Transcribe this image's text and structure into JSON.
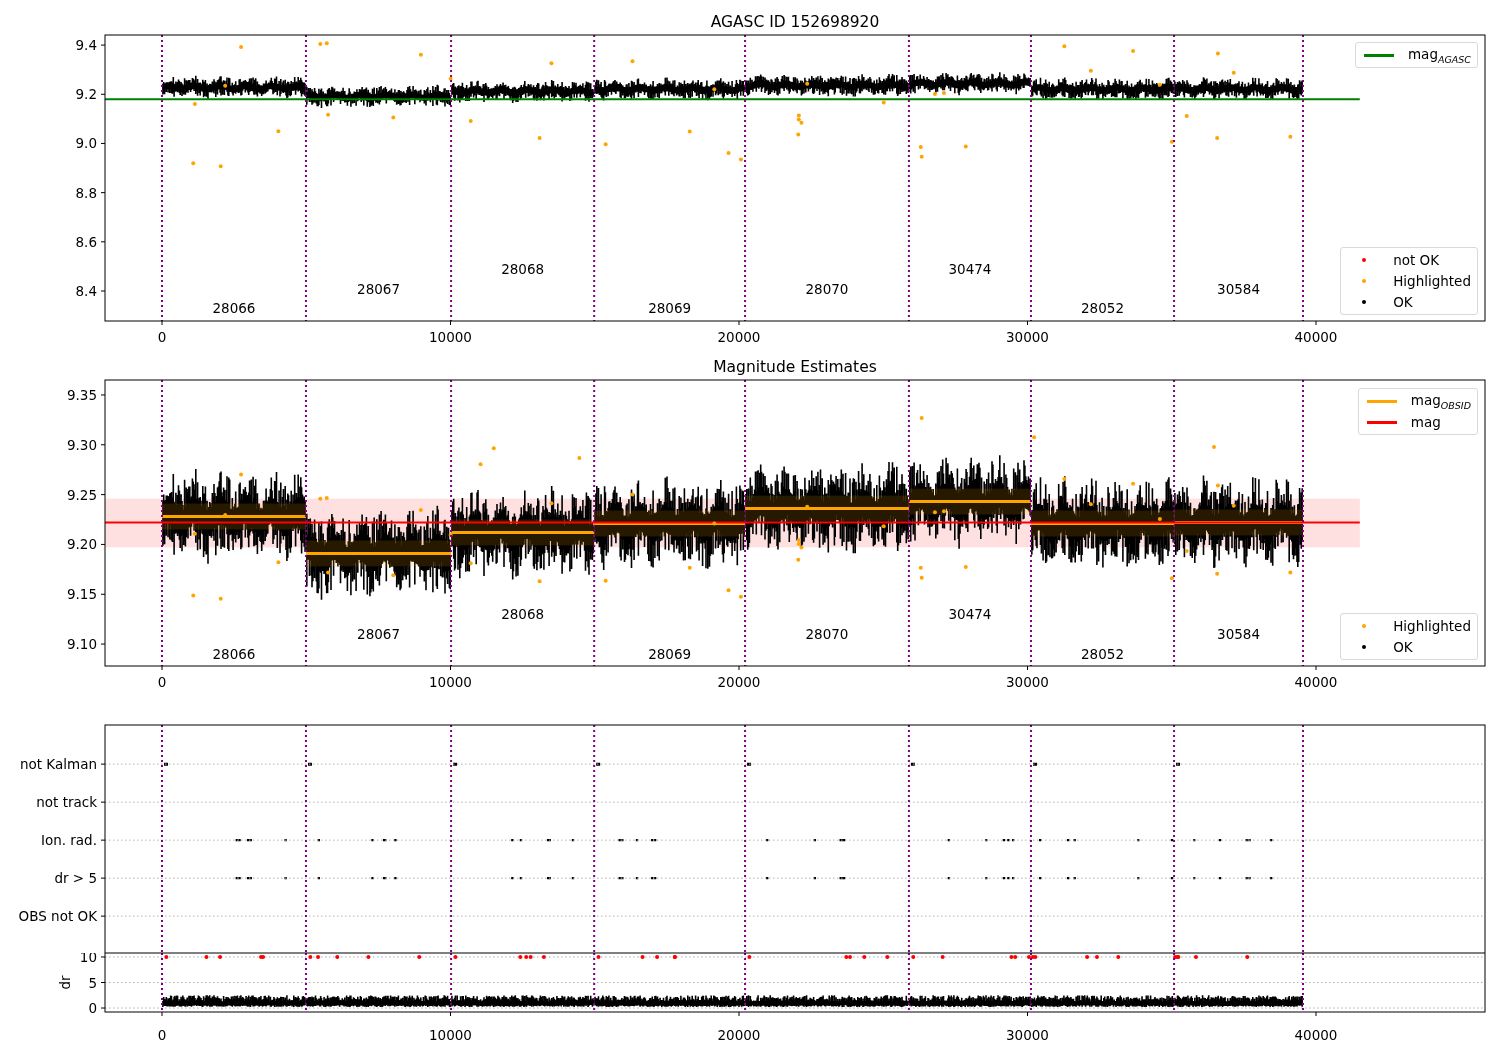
{
  "figure": {
    "panels": [
      {
        "kind": "mag",
        "chart_data": {
          "type": "line",
          "title": "AGASC ID 152698920",
          "xlim": [
            -1976,
            45858
          ],
          "ylim": [
            8.278,
            9.441
          ],
          "xticks": [
            {
              "value": 0,
              "label": "0"
            },
            {
              "value": 10000,
              "label": "10000"
            },
            {
              "value": 20000,
              "label": "20000"
            },
            {
              "value": 30000,
              "label": "30000"
            },
            {
              "value": 40000,
              "label": "40000"
            }
          ],
          "yticks": [
            {
              "value": 8.4,
              "label": "8.4"
            },
            {
              "value": 8.6,
              "label": "8.6"
            },
            {
              "value": 8.8,
              "label": "8.8"
            },
            {
              "value": 9.0,
              "label": "9.0"
            },
            {
              "value": 9.2,
              "label": "9.2"
            },
            {
              "value": 9.4,
              "label": "9.4"
            }
          ],
          "series": [
            {
              "name": "mag$_{AGASC}$",
              "color": "#008000",
              "x": [
                -1976,
                41520
              ],
              "values": [
                9.18,
                9.18
              ]
            }
          ],
          "legend": "upper right",
          "ref_lines": [
            {
              "axis": "x",
              "value": 0
            },
            {
              "axis": "x",
              "value": 4990
            },
            {
              "axis": "x",
              "value": 10020
            },
            {
              "axis": "x",
              "value": 14980
            },
            {
              "axis": "x",
              "value": 20210
            },
            {
              "axis": "x",
              "value": 25890
            },
            {
              "axis": "x",
              "value": 30120
            },
            {
              "axis": "x",
              "value": 35080
            },
            {
              "axis": "x",
              "value": 39550
            }
          ],
          "annotations": [
            "28066",
            "28067",
            "28068",
            "28069",
            "28070",
            "30474",
            "28052",
            "30584"
          ]
        },
        "markers_legend": {
          "items": [
            {
              "label": "not OK",
              "color": "#ff0000"
            },
            {
              "label": "Highlighted",
              "color": "#ffa500"
            },
            {
              "label": "OK",
              "color": "#000000"
            }
          ]
        }
      },
      {
        "kind": "estimates",
        "chart_data": {
          "type": "line",
          "title": "Magnitude Estimates",
          "xlim": [
            -1976,
            45858
          ],
          "ylim": [
            9.078,
            9.365
          ],
          "xticks": [
            {
              "value": 0,
              "label": "0"
            },
            {
              "value": 10000,
              "label": "10000"
            },
            {
              "value": 20000,
              "label": "20000"
            },
            {
              "value": 30000,
              "label": "30000"
            },
            {
              "value": 40000,
              "label": "40000"
            }
          ],
          "yticks": [
            {
              "value": 9.1,
              "label": "9.10"
            },
            {
              "value": 9.15,
              "label": "9.15"
            },
            {
              "value": 9.2,
              "label": "9.20"
            },
            {
              "value": 9.25,
              "label": "9.25"
            },
            {
              "value": 9.3,
              "label": "9.30"
            },
            {
              "value": 9.35,
              "label": "9.35"
            }
          ],
          "series": [
            {
              "name": "mag$_{OBSID}$",
              "color": "#ffa500",
              "x": [
                0,
                4990,
                4990,
                10020,
                10020,
                14980,
                14980,
                20210,
                20210,
                25890,
                25890,
                30120,
                30120,
                35080,
                35080,
                39550
              ],
              "values": [
                9.228,
                9.228,
                9.191,
                9.191,
                9.212,
                9.212,
                9.221,
                9.221,
                9.236,
                9.236,
                9.243,
                9.243,
                9.221,
                9.221,
                9.222,
                9.222
              ]
            },
            {
              "name": "mag",
              "color": "#ff0000",
              "x": [
                -1976,
                41520
              ],
              "values": [
                9.222,
                9.222
              ]
            }
          ],
          "legend": "upper right",
          "bands": [
            {
              "axis": "y",
              "from": 9.197,
              "to": 9.246
            }
          ],
          "ref_lines": [
            {
              "axis": "x",
              "value": 0
            },
            {
              "axis": "x",
              "value": 4990
            },
            {
              "axis": "x",
              "value": 10020
            },
            {
              "axis": "x",
              "value": 14980
            },
            {
              "axis": "x",
              "value": 20210
            },
            {
              "axis": "x",
              "value": 25890
            },
            {
              "axis": "x",
              "value": 30120
            },
            {
              "axis": "x",
              "value": 35080
            },
            {
              "axis": "x",
              "value": 39550
            }
          ],
          "annotations": [
            "28066",
            "28067",
            "28068",
            "28069",
            "28070",
            "30474",
            "28052",
            "30584"
          ]
        },
        "markers_legend": {
          "items": [
            {
              "label": "Highlighted",
              "color": "#ffa500"
            },
            {
              "label": "OK",
              "color": "#000000"
            }
          ]
        }
      },
      {
        "kind": "flags",
        "chart_data": {
          "type": "scatter",
          "xlim": [
            -1976,
            45858
          ],
          "orientation": "horizontal",
          "categories": [
            "not Kalman",
            "not track",
            "Ion. rad.",
            "dr > 5",
            "OBS not OK"
          ],
          "grid": true,
          "ref_lines": [
            {
              "axis": "x",
              "value": 0
            },
            {
              "axis": "x",
              "value": 4990
            },
            {
              "axis": "x",
              "value": 10020
            },
            {
              "axis": "x",
              "value": 14980
            },
            {
              "axis": "x",
              "value": 20210
            },
            {
              "axis": "x",
              "value": 25890
            },
            {
              "axis": "x",
              "value": 30120
            },
            {
              "axis": "x",
              "value": 35080
            },
            {
              "axis": "x",
              "value": 39550
            }
          ]
        }
      },
      {
        "kind": "dr",
        "chart_data": {
          "type": "scatter",
          "ylabel": "dr",
          "xlim": [
            -1976,
            45858
          ],
          "ylim": [
            -0.78,
            10.78
          ],
          "grid": true,
          "xticks": [
            {
              "value": 0,
              "label": "0"
            },
            {
              "value": 10000,
              "label": "10000"
            },
            {
              "value": 20000,
              "label": "20000"
            },
            {
              "value": 30000,
              "label": "30000"
            },
            {
              "value": 40000,
              "label": "40000"
            }
          ],
          "yticks": [
            {
              "value": 0,
              "label": "0"
            },
            {
              "value": 5,
              "label": "5"
            },
            {
              "value": 10,
              "label": "10"
            }
          ],
          "ref_lines": [
            {
              "axis": "x",
              "value": 0
            },
            {
              "axis": "x",
              "value": 4990
            },
            {
              "axis": "x",
              "value": 10020
            },
            {
              "axis": "x",
              "value": 14980
            },
            {
              "axis": "x",
              "value": 20210
            },
            {
              "axis": "x",
              "value": 25890
            },
            {
              "axis": "x",
              "value": 30120
            },
            {
              "axis": "x",
              "value": 35080
            },
            {
              "axis": "x",
              "value": 39550
            }
          ]
        }
      }
    ]
  }
}
